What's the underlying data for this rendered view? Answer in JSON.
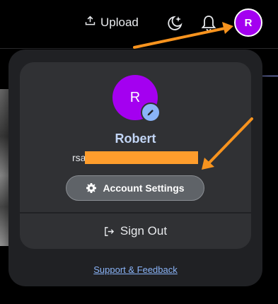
{
  "header": {
    "upload_label": "Upload",
    "avatar_initial": "R"
  },
  "account_menu": {
    "avatar_initial": "R",
    "name": "Robert",
    "email_visible": "rsa",
    "account_settings_label": "Account Settings",
    "sign_out_label": "Sign Out",
    "support_link_label": "Support & Feedback"
  },
  "colors": {
    "avatar": "#a400f0",
    "link": "#8ab4f8",
    "annotation_arrow": "#f7931e"
  },
  "icons": [
    "upload-icon",
    "theme-toggle-icon",
    "bell-icon",
    "pencil-icon",
    "gear-icon",
    "sign-out-icon"
  ]
}
